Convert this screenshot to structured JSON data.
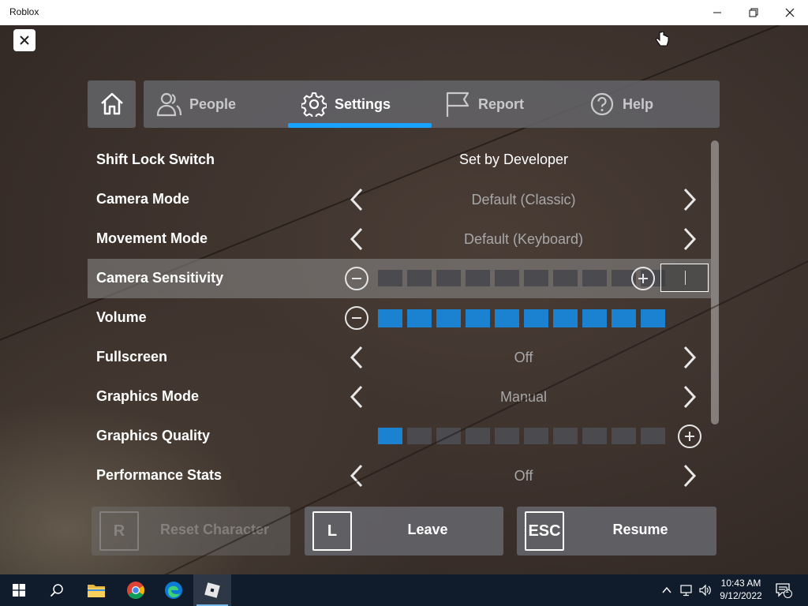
{
  "window": {
    "title": "Roblox"
  },
  "tabs": {
    "home_icon": "home-icon",
    "items": [
      {
        "label": "People",
        "icon": "people-icon"
      },
      {
        "label": "Settings",
        "icon": "gear-icon"
      },
      {
        "label": "Report",
        "icon": "flag-icon"
      },
      {
        "label": "Help",
        "icon": "help-icon"
      }
    ],
    "active": "Settings",
    "accent": "#19a3ff"
  },
  "settings": {
    "rows": [
      {
        "label": "Shift Lock Switch",
        "value": "Set by Developer"
      },
      {
        "label": "Camera Mode",
        "value": "Default (Classic)"
      },
      {
        "label": "Movement Mode",
        "value": "Default (Keyboard)"
      },
      {
        "label": "Camera Sensitivity",
        "level_filled": 0,
        "level_total": 10,
        "input_value": ""
      },
      {
        "label": "Volume",
        "level_filled": 10,
        "level_total": 10
      },
      {
        "label": "Fullscreen",
        "value": "Off"
      },
      {
        "label": "Graphics Mode",
        "value": "Manual"
      },
      {
        "label": "Graphics Quality",
        "level_filled": 1,
        "level_total": 10
      },
      {
        "label": "Performance Stats",
        "value": "Off"
      }
    ],
    "bar_on_color": "#1a82d0",
    "bar_off_color": "#4a4a4f"
  },
  "actions": {
    "reset": {
      "key": "R",
      "label": "Reset Character"
    },
    "leave": {
      "key": "L",
      "label": "Leave"
    },
    "resume": {
      "key": "ESC",
      "label": "Resume"
    }
  },
  "taskbar": {
    "time": "10:43 AM",
    "date": "9/12/2022",
    "notifications": "1"
  }
}
